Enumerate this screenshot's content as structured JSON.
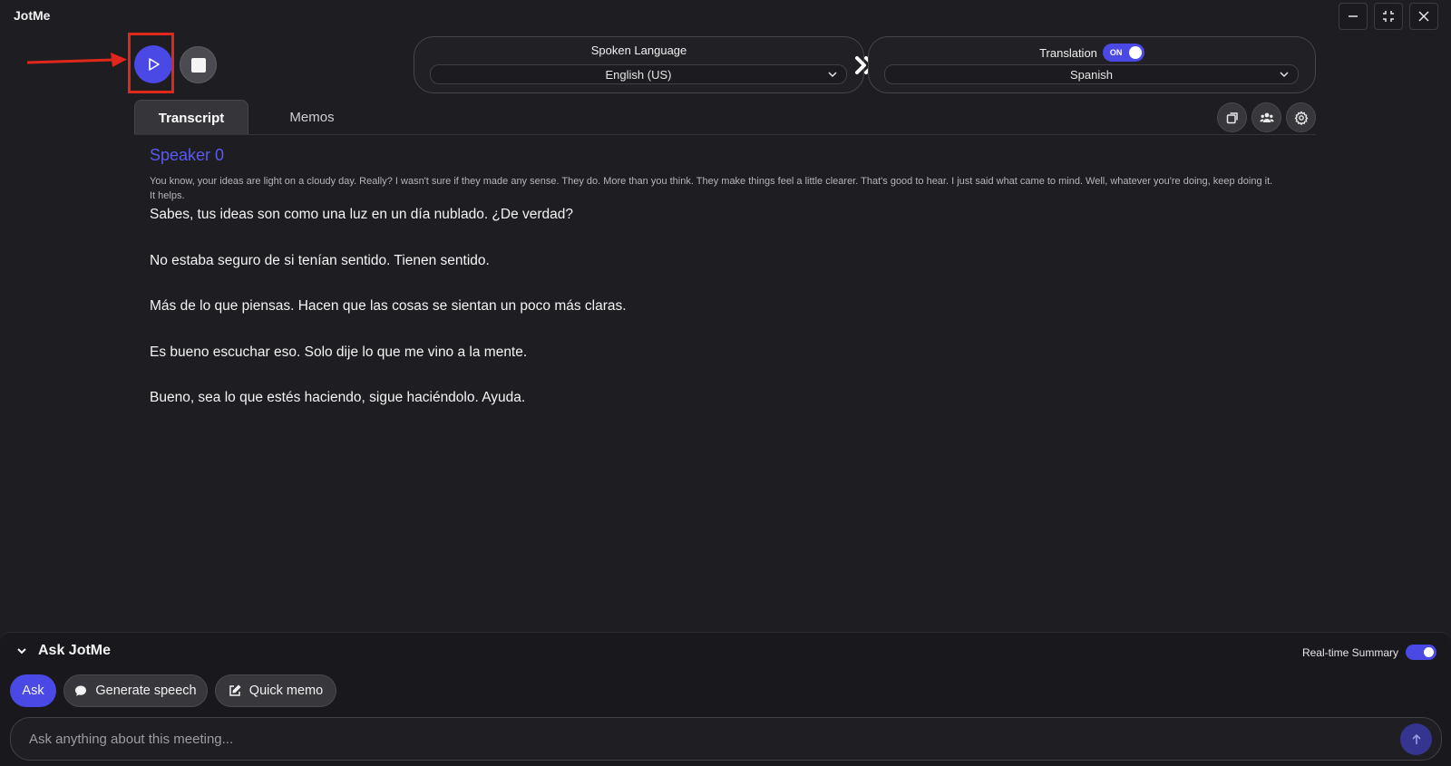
{
  "app": {
    "title": "JotMe"
  },
  "window_controls": [
    "minimize-icon",
    "fullscreen-icon",
    "close-icon"
  ],
  "recording": {
    "play_icon": "play-icon",
    "stop_icon": "stop-icon"
  },
  "spoken_language": {
    "label": "Spoken Language",
    "value": "English (US)"
  },
  "translation": {
    "label": "Translation",
    "toggle_text": "ON",
    "enabled": true,
    "value": "Spanish"
  },
  "tabs": [
    {
      "label": "Transcript",
      "active": true
    },
    {
      "label": "Memos",
      "active": false
    }
  ],
  "toolbar_icons": [
    "copy-icon",
    "participants-icon",
    "settings-icon"
  ],
  "transcript": {
    "speaker": "Speaker 0",
    "original": "You know, your ideas are light on a cloudy day. Really? I wasn't sure if they made any sense. They do. More than you think. They make things feel a little clearer. That's good to hear. I just said what came to mind. Well, whatever you're doing, keep doing it. It helps.",
    "translations": [
      "Sabes, tus ideas son como una luz en un día nublado. ¿De verdad?",
      "No estaba seguro de si tenían sentido. Tienen sentido.",
      "Más de lo que piensas. Hacen que las cosas se sientan un poco más claras.",
      "Es bueno escuchar eso. Solo dije lo que me vino a la mente.",
      "Bueno, sea lo que estés haciendo, sigue haciéndolo. Ayuda."
    ]
  },
  "ask_panel": {
    "title": "Ask JotMe",
    "realtime_summary_label": "Real-time Summary",
    "realtime_summary_enabled": true,
    "chips": [
      {
        "label": "Ask",
        "icon": ""
      },
      {
        "label": "Generate speech",
        "icon": "speech-bubble-icon"
      },
      {
        "label": "Quick memo",
        "icon": "edit-icon"
      }
    ],
    "input_placeholder": "Ask anything about this meeting...",
    "send_icon": "arrow-up-icon"
  },
  "colors": {
    "accent": "#4a49e6",
    "speaker": "#5a5af2",
    "annotation": "#e1261c",
    "background": "#1e1d21"
  }
}
